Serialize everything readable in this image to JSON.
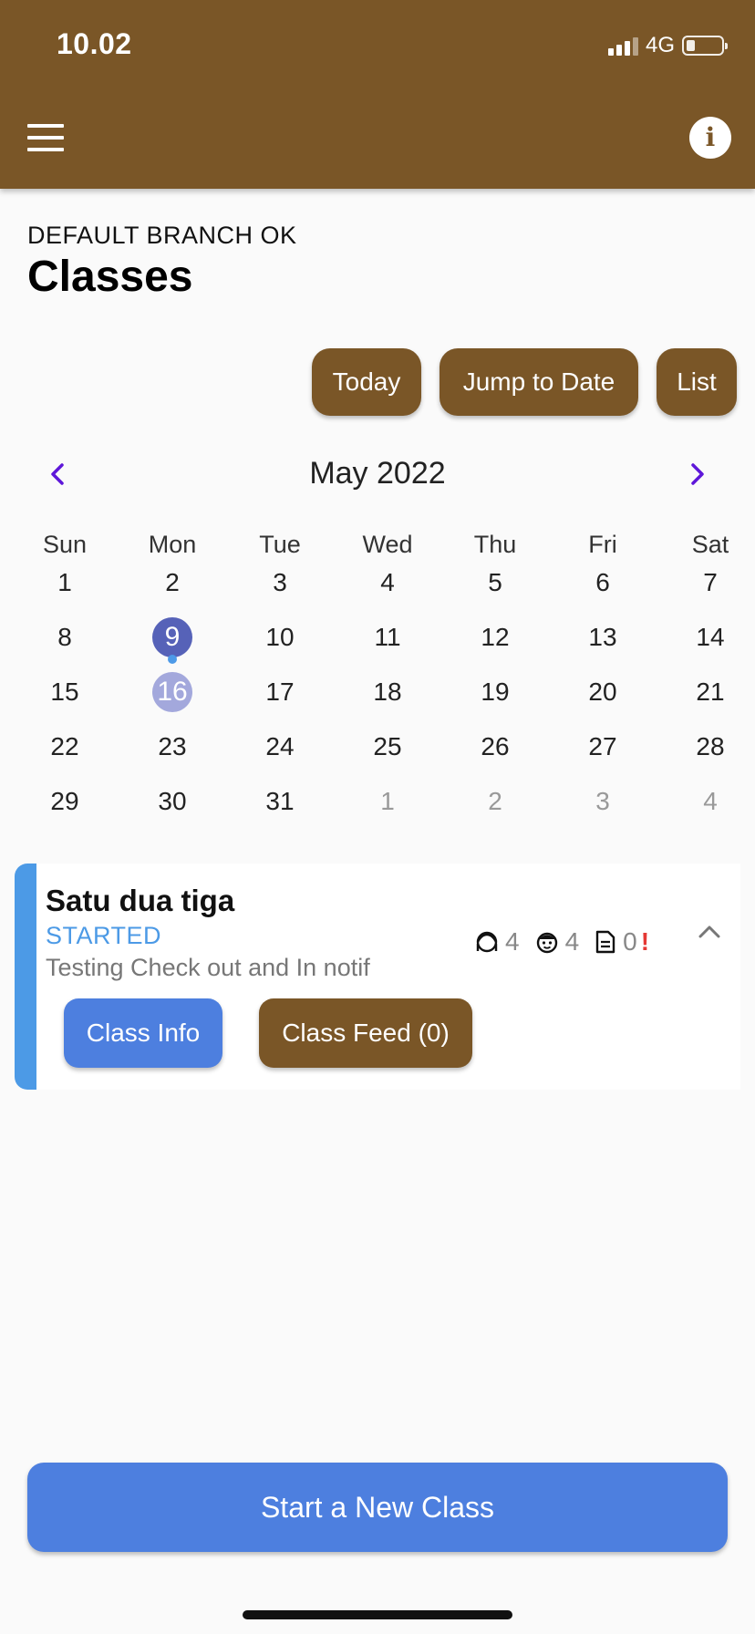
{
  "status_bar": {
    "time": "10.02",
    "network": "4G"
  },
  "header": {
    "menu_icon": "hamburger-icon",
    "info_icon": "info-icon"
  },
  "page": {
    "branch": "DEFAULT BRANCH OK",
    "title": "Classes"
  },
  "toolbar": {
    "today": "Today",
    "jump": "Jump to Date",
    "list": "List"
  },
  "calendar": {
    "month_label": "May 2022",
    "prev_icon": "‹",
    "next_icon": "›",
    "weekdays": [
      "Sun",
      "Mon",
      "Tue",
      "Wed",
      "Thu",
      "Fri",
      "Sat"
    ],
    "weeks": [
      [
        "1",
        "2",
        "3",
        "4",
        "5",
        "6",
        "7"
      ],
      [
        "8",
        "9",
        "10",
        "11",
        "12",
        "13",
        "14"
      ],
      [
        "15",
        "16",
        "17",
        "18",
        "19",
        "20",
        "21"
      ],
      [
        "22",
        "23",
        "24",
        "25",
        "26",
        "27",
        "28"
      ],
      [
        "29",
        "30",
        "31",
        "1",
        "2",
        "3",
        "4"
      ]
    ],
    "selected_day": "9",
    "today_day": "16",
    "colors": {
      "selected": "#5662b8",
      "today": "#a3a8dc",
      "event_dot": "#4d9ae8",
      "nav": "#5e17d9"
    }
  },
  "class_card": {
    "name": "Satu dua tiga",
    "status": "STARTED",
    "description": "Testing Check out and In notif",
    "stats": {
      "teachers": "4",
      "students": "4",
      "notes": "0",
      "alert": "!"
    },
    "info_button": "Class Info",
    "feed_button": "Class Feed (0)",
    "accent": "#4c9ae6"
  },
  "footer": {
    "start_button": "Start a New Class"
  },
  "colors": {
    "brand": "#7a5627",
    "primary": "#4d7fdf"
  }
}
